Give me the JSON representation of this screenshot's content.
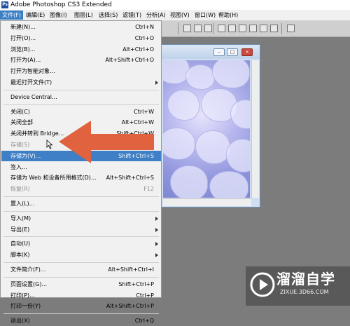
{
  "app": {
    "title": "Adobe Photoshop CS3 Extended",
    "logo_text": "Ps"
  },
  "menubar": [
    {
      "label": "文件(F)",
      "active": true
    },
    {
      "label": "编辑(E)"
    },
    {
      "label": "图像(I)"
    },
    {
      "label": "图层(L)"
    },
    {
      "label": "选择(S)"
    },
    {
      "label": "滤镜(T)"
    },
    {
      "label": "分析(A)"
    },
    {
      "label": "视图(V)"
    },
    {
      "label": "窗口(W)"
    },
    {
      "label": "帮助(H)"
    }
  ],
  "file_menu": [
    {
      "label": "新建(N)...",
      "shortcut": "Ctrl+N"
    },
    {
      "label": "打开(O)...",
      "shortcut": "Ctrl+O"
    },
    {
      "label": "浏览(B)...",
      "shortcut": "Alt+Ctrl+O"
    },
    {
      "label": "打开为(A)...",
      "shortcut": "Alt+Shift+Ctrl+O"
    },
    {
      "label": "打开为智能对象...",
      "shortcut": ""
    },
    {
      "label": "最近打开文件(T)",
      "shortcut": "",
      "submenu": true
    },
    {
      "separator": true
    },
    {
      "label": "Device Central...",
      "shortcut": ""
    },
    {
      "separator": true
    },
    {
      "label": "关闭(C)",
      "shortcut": "Ctrl+W"
    },
    {
      "label": "关闭全部",
      "shortcut": "Alt+Ctrl+W"
    },
    {
      "label": "关闭并转到 Bridge...",
      "shortcut": "Shift+Ctrl+W"
    },
    {
      "label": "存储(S)",
      "shortcut": "Ctrl+S",
      "disabled": true
    },
    {
      "label": "存储为(V)...",
      "shortcut": "Shift+Ctrl+S",
      "highlighted": true
    },
    {
      "label": "签入...",
      "shortcut": ""
    },
    {
      "label": "存储为 Web 和设备所用格式(D)...",
      "shortcut": "Alt+Shift+Ctrl+S"
    },
    {
      "label": "恢复(R)",
      "shortcut": "F12",
      "disabled": true
    },
    {
      "separator": true
    },
    {
      "label": "置入(L)...",
      "shortcut": ""
    },
    {
      "separator": true
    },
    {
      "label": "导入(M)",
      "shortcut": "",
      "submenu": true
    },
    {
      "label": "导出(E)",
      "shortcut": "",
      "submenu": true
    },
    {
      "separator": true
    },
    {
      "label": "自动(U)",
      "shortcut": "",
      "submenu": true
    },
    {
      "label": "脚本(K)",
      "shortcut": "",
      "submenu": true
    },
    {
      "separator": true
    },
    {
      "label": "文件简介(F)...",
      "shortcut": "Alt+Shift+Ctrl+I"
    },
    {
      "separator": true
    },
    {
      "label": "页面设置(G)...",
      "shortcut": "Shift+Ctrl+P"
    },
    {
      "label": "打印(P)...",
      "shortcut": "Ctrl+P"
    },
    {
      "label": "打印一份(Y)",
      "shortcut": "Alt+Shift+Ctrl+P"
    },
    {
      "separator": true
    },
    {
      "label": "退出(X)",
      "shortcut": "Ctrl+Q"
    }
  ],
  "document_window": {
    "buttons": [
      "minimize",
      "maximize",
      "close"
    ]
  },
  "annotation": {
    "arrow_color": "#e0623f",
    "points_to": "存储为(V)..."
  },
  "watermark": {
    "brand": "溜溜自学",
    "url": "ZIXUE.3D66.COM"
  },
  "colors": {
    "highlight": "#3f7fc5",
    "workspace": "#7c7c7c",
    "arrow": "#e0623f"
  }
}
